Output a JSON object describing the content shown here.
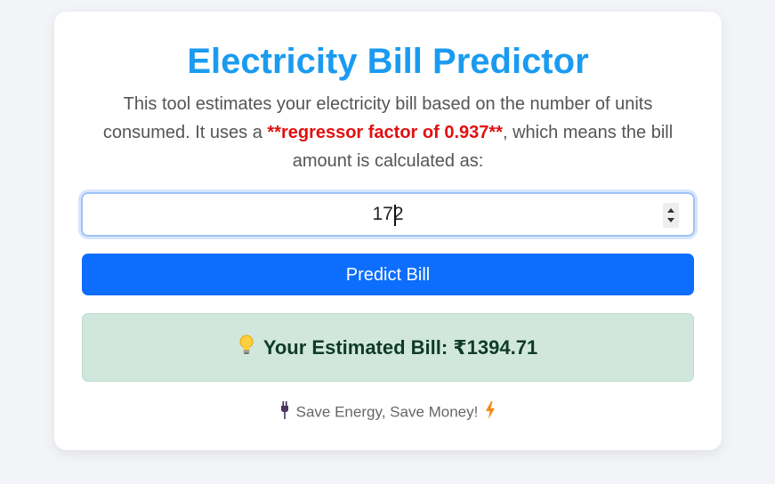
{
  "title": "Electricity Bill Predictor",
  "description": {
    "before": "This tool estimates your electricity bill based on the number of units consumed. It uses a ",
    "highlight": "**regressor factor of 0.937**",
    "after": ", which means the bill amount is calculated as:"
  },
  "units_input": {
    "value": "172"
  },
  "predict_button": {
    "label": "Predict Bill"
  },
  "result": {
    "label": "Your Estimated Bill:",
    "amount": "₹1394.71",
    "icon": "lightbulb-icon"
  },
  "footer": {
    "text": "Save Energy, Save Money!",
    "left_icon": "plug-icon",
    "right_icon": "lightning-icon"
  },
  "colors": {
    "title": "#1a9bf0",
    "highlight": "#e01010",
    "button": "#0d6efd",
    "result_bg": "#d1e7dd",
    "result_text": "#0f3b26"
  }
}
